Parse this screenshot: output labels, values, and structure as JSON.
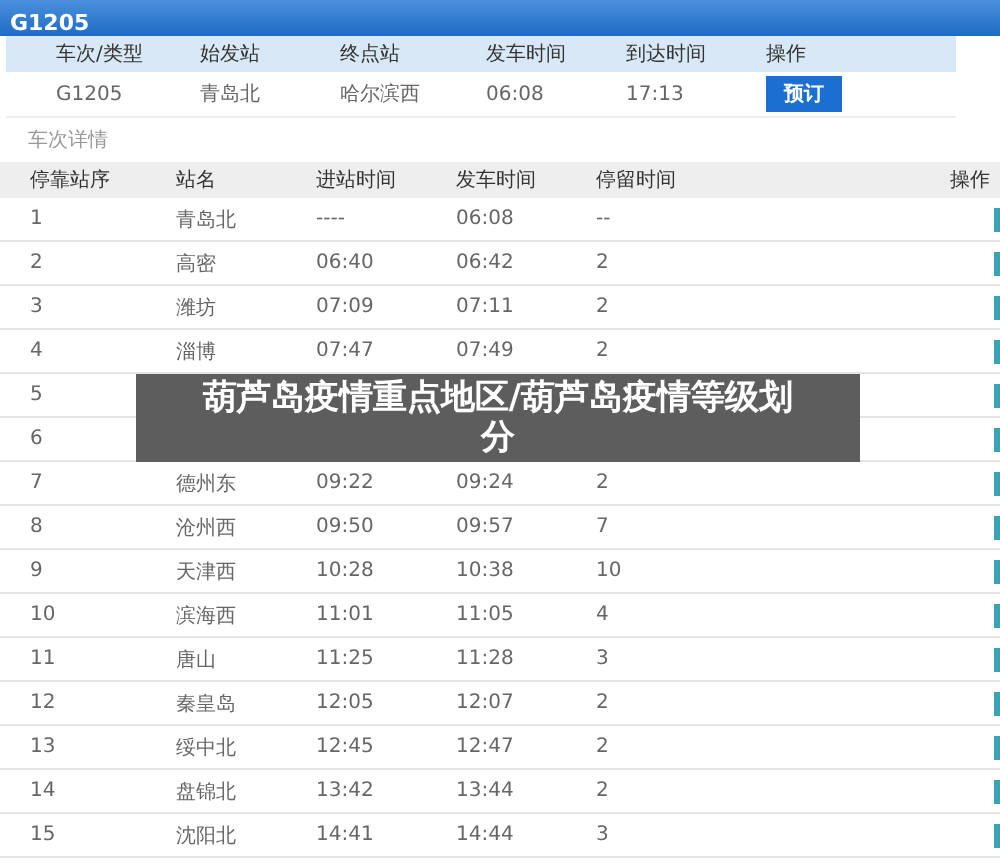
{
  "title_bar": {
    "title": "G1205"
  },
  "summary": {
    "columns": [
      "车次/类型",
      "始发站",
      "终点站",
      "发车时间",
      "到达时间",
      "操作"
    ],
    "row": {
      "train": "G1205",
      "origin": "青岛北",
      "destination": "哈尔滨西",
      "depart": "06:08",
      "arrive": "17:13",
      "button": "预订"
    }
  },
  "section_label": "车次详情",
  "stops": {
    "columns": [
      "停靠站序",
      "站名",
      "进站时间",
      "发车时间",
      "停留时间",
      "操作"
    ],
    "rows": [
      {
        "seq": "1",
        "station": "青岛北",
        "arrive": "----",
        "depart": "06:08",
        "stay": "--"
      },
      {
        "seq": "2",
        "station": "高密",
        "arrive": "06:40",
        "depart": "06:42",
        "stay": "2"
      },
      {
        "seq": "3",
        "station": "潍坊",
        "arrive": "07:09",
        "depart": "07:11",
        "stay": "2"
      },
      {
        "seq": "4",
        "station": "淄博",
        "arrive": "07:47",
        "depart": "07:49",
        "stay": "2"
      },
      {
        "seq": "5"
      },
      {
        "seq": "6"
      },
      {
        "seq": "7",
        "station": "德州东",
        "arrive": "09:22",
        "depart": "09:24",
        "stay": "2"
      },
      {
        "seq": "8",
        "station": "沧州西",
        "arrive": "09:50",
        "depart": "09:57",
        "stay": "7"
      },
      {
        "seq": "9",
        "station": "天津西",
        "arrive": "10:28",
        "depart": "10:38",
        "stay": "10"
      },
      {
        "seq": "10",
        "station": "滨海西",
        "arrive": "11:01",
        "depart": "11:05",
        "stay": "4"
      },
      {
        "seq": "11",
        "station": "唐山",
        "arrive": "11:25",
        "depart": "11:28",
        "stay": "3"
      },
      {
        "seq": "12",
        "station": "秦皇岛",
        "arrive": "12:05",
        "depart": "12:07",
        "stay": "2"
      },
      {
        "seq": "13",
        "station": "绥中北",
        "arrive": "12:45",
        "depart": "12:47",
        "stay": "2"
      },
      {
        "seq": "14",
        "station": "盘锦北",
        "arrive": "13:42",
        "depart": "13:44",
        "stay": "2"
      },
      {
        "seq": "15",
        "station": "沈阳北",
        "arrive": "14:41",
        "depart": "14:44",
        "stay": "3"
      }
    ]
  },
  "caption_banner": "葫芦岛疫情重点地区/葫芦岛疫情等级划分"
}
